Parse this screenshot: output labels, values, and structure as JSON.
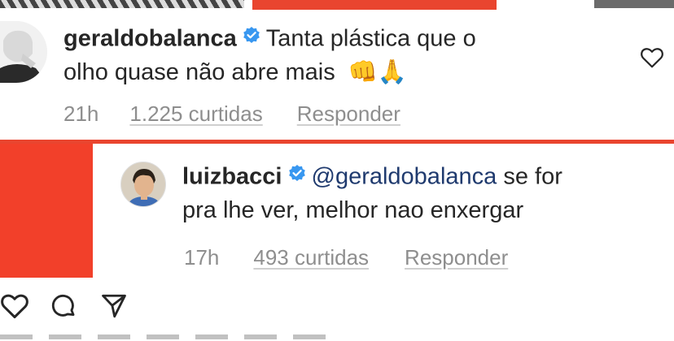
{
  "comments": [
    {
      "username": "geraldobalanca",
      "verified": true,
      "text_line1": "Tanta plástica que o",
      "text_line2": "olho quase não abre mais",
      "emojis": "👊🙏",
      "time": "21h",
      "likes": "1.225 curtidas",
      "reply": "Responder"
    },
    {
      "username": "luizbacci",
      "verified": true,
      "mention": "@geraldobalanca",
      "text_line1_rest": "se for",
      "text_line2": "pra lhe ver, melhor nao enxergar",
      "time": "17h",
      "likes": "493 curtidas",
      "reply": "Responder"
    }
  ],
  "icons": {
    "like_comment": "heart-outline-icon",
    "verified": "verified-badge-icon",
    "actions": [
      "heart-outline-icon",
      "comment-bubble-icon",
      "send-paper-plane-icon"
    ]
  },
  "colors": {
    "text": "#262626",
    "muted": "#8e8e8e",
    "verified_blue": "#3897f0",
    "accent_red": "#f2402a",
    "mention": "#1f3a6e"
  }
}
